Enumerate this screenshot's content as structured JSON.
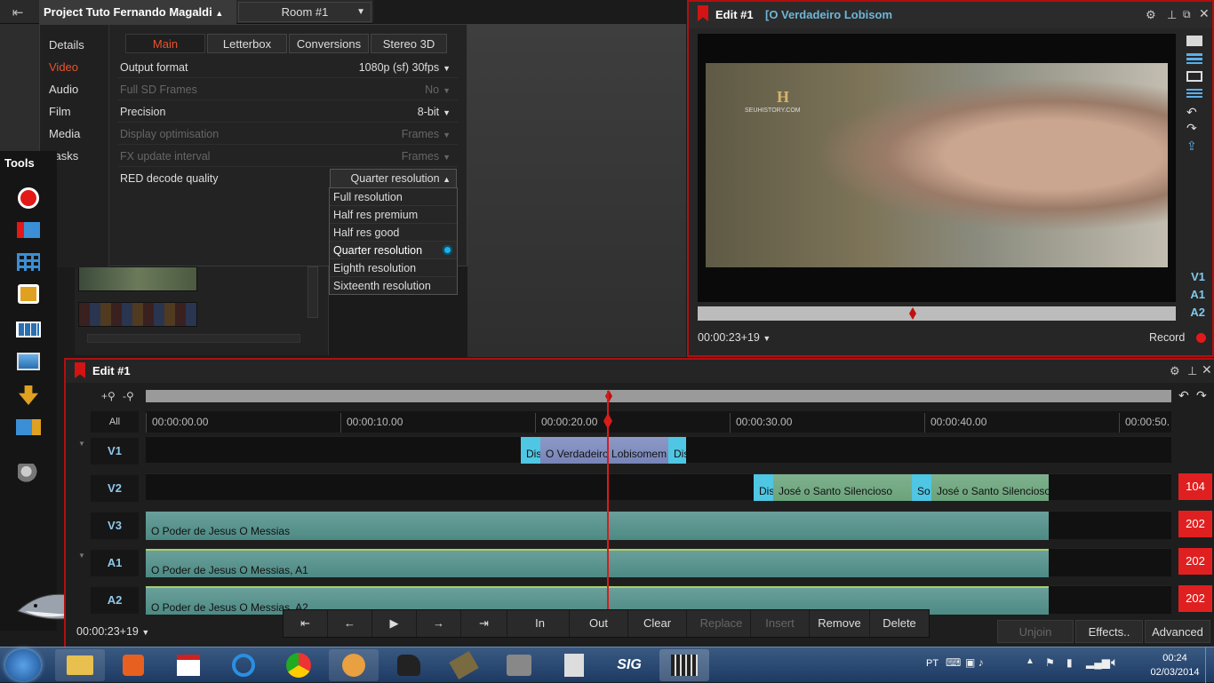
{
  "topbar": {
    "project_title": "Project Tuto Fernando Magaldi",
    "room": "Room #1"
  },
  "project_panel": {
    "nav": [
      "Details",
      "Video",
      "Audio",
      "Film",
      "Media",
      "Tasks"
    ],
    "active_nav": "Video",
    "tabs": [
      "Main",
      "Letterbox",
      "Conversions",
      "Stereo 3D"
    ],
    "active_tab": "Main",
    "rows": [
      {
        "label": "Output format",
        "value": "1080p (sf) 30fps",
        "dim": false
      },
      {
        "label": "Full SD Frames",
        "value": "No",
        "dim": true
      },
      {
        "label": "Precision",
        "value": "8-bit",
        "dim": false
      },
      {
        "label": "Display optimisation",
        "value": "Frames",
        "dim": true
      },
      {
        "label": "FX update interval",
        "value": "Frames",
        "dim": true
      },
      {
        "label": "RED decode quality",
        "value": "Quarter resolution",
        "dim": false
      }
    ],
    "dropdown_options": [
      "Full resolution",
      "Half res premium",
      "Half res good",
      "Quarter resolution",
      "Eighth resolution",
      "Sixteenth resolution"
    ],
    "dropdown_selected": "Quarter resolution"
  },
  "tools": {
    "label": "Tools"
  },
  "viewer": {
    "title": "Edit #1",
    "subtitle": "[O Verdadeiro Lobisom",
    "logo_letter": "H",
    "logo_sub": "SEUHISTORY.COM",
    "timecode": "00:00:23+19",
    "record_label": "Record",
    "tracks": [
      "V1",
      "A1",
      "A2"
    ]
  },
  "timeline": {
    "title": "Edit #1",
    "all_label": "All",
    "ticks": [
      "00:00:00.00",
      "00:00:10.00",
      "00:00:20.00",
      "00:00:30.00",
      "00:00:40.00",
      "00:00:50."
    ],
    "tracks": [
      {
        "name": "V1",
        "count": ""
      },
      {
        "name": "V2",
        "count": "104"
      },
      {
        "name": "V3",
        "count": "202"
      },
      {
        "name": "A1",
        "count": "202"
      },
      {
        "name": "A2",
        "count": "202"
      }
    ],
    "clips": {
      "v1_dis1": "Dis",
      "v1_main": "O Verdadeiro Lobisomem",
      "v1_dis2": "Dis",
      "v2_dis": "Dis",
      "v2_jose1": "José o Santo Silencioso",
      "v2_so": "So",
      "v2_jose2": "José o Santo Silencioso",
      "v3_main": "O Poder de Jesus   O Messias",
      "a1_main": "O Poder de Jesus   O Messias, A1",
      "a2_main": "O Poder de Jesus   O Messias, A2"
    },
    "timecode": "00:00:23+19"
  },
  "transport": {
    "buttons": [
      "In",
      "Out",
      "Clear",
      "Replace",
      "Insert",
      "Remove",
      "Delete"
    ],
    "right_buttons": [
      "Unjoin",
      "Effects..",
      "Advanced"
    ]
  },
  "taskbar": {
    "lang": "PT",
    "time": "00:24",
    "date": "02/03/2014"
  }
}
